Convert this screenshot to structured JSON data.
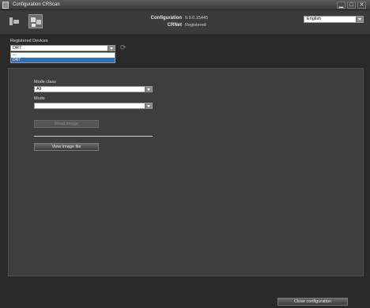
{
  "window": {
    "title": "Configuration CRScan",
    "minimize_glyph": "▁",
    "maximize_glyph": "□",
    "close_glyph": "✕"
  },
  "header": {
    "title": "Configuration",
    "subtitle": "CRNet",
    "version": "9.9.0.15445",
    "registration_status": "Registered",
    "language": "English"
  },
  "devices": {
    "label": "Registered Devices",
    "selected": "DR7",
    "options": [
      "---",
      "DR7"
    ]
  },
  "mode_class": {
    "label": "Mode class",
    "value": "All"
  },
  "mode": {
    "label": "Mode",
    "value": ""
  },
  "buttons": {
    "read_image": "Read image",
    "view_image_file": "View image file",
    "close_configuration": "Close configuration"
  },
  "colors": {
    "background": "#2a2a2a",
    "panel": "#3e3e3e",
    "selection": "#2f6fb3"
  },
  "icons": [
    "app-icon",
    "scanner-icon",
    "settings-icon",
    "refresh-icon"
  ]
}
